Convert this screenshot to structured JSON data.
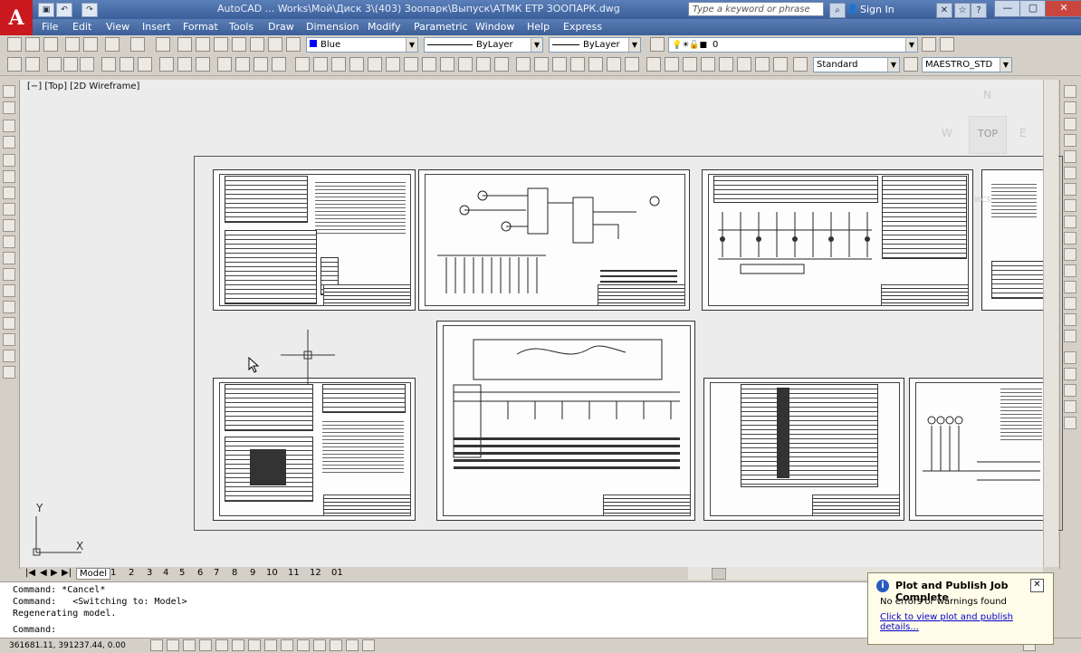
{
  "title_bar": {
    "title": "AutoCAD ... Works\\Мой\\Диск 3\\(403) Зоопарк\\Выпуск\\АТМК ЕТР ЗООПАРК.dwg",
    "search_placeholder": "Type a keyword or phrase",
    "sign_in": "Sign In",
    "app_logo": "A"
  },
  "menu": [
    "File",
    "Edit",
    "View",
    "Insert",
    "Format",
    "Tools",
    "Draw",
    "Dimension",
    "Modify",
    "Parametric",
    "Window",
    "Help",
    "Express"
  ],
  "properties": {
    "color": "Blue",
    "linetype": "ByLayer",
    "lineweight": "ByLayer",
    "layer": "0",
    "text_style": "Standard",
    "dim_style": "MAESTRO_STD"
  },
  "viewport": {
    "label": "[−] [Top] [2D Wireframe]",
    "viewcube_top": "TOP",
    "compass_n": "N",
    "compass_w": "W",
    "compass_e": "E",
    "wcs": "WCS",
    "ucs_y": "Y",
    "ucs_x": "X"
  },
  "tabs": {
    "model": "Model",
    "layouts": [
      "1",
      "2",
      "3",
      "4",
      "5",
      "6",
      "7",
      "8",
      "9",
      "10",
      "11",
      "12",
      "01"
    ]
  },
  "command_history": [
    "Command: *Cancel*",
    "Command:   <Switching to: Model>",
    "Regenerating model."
  ],
  "command_prompt": "Command:",
  "status": {
    "coordinates": "361681.11, 391237.44, 0.00"
  },
  "notification": {
    "title": "Plot and Publish Job Complete",
    "body": "No errors or warnings found",
    "link": "Click to view plot and publish details..."
  }
}
